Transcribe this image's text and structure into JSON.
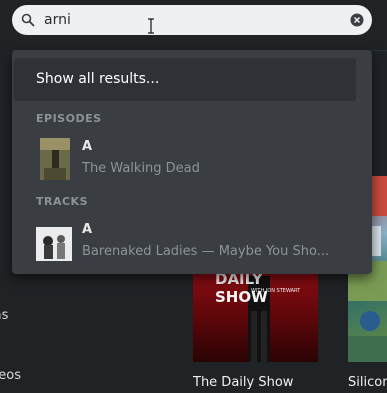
{
  "search": {
    "value": "arni",
    "placeholder": ""
  },
  "dropdown": {
    "show_all_label": "Show all results...",
    "sections": [
      {
        "header": "EPISODES",
        "items": [
          {
            "title": "A",
            "subtitle": "The Walking Dead"
          }
        ]
      },
      {
        "header": "TRACKS",
        "items": [
          {
            "title": "A",
            "subtitle": "Barenaked Ladies — Maybe You Sho..."
          }
        ]
      }
    ]
  },
  "sidebar": {
    "items": [
      "ias",
      "e",
      "deos"
    ]
  },
  "posters": [
    {
      "title": "The Daily Show",
      "poster_text": "DAILY SHOW",
      "poster_subtext": "WITH JON STEWART"
    },
    {
      "title": "Silicon"
    }
  ],
  "colors": {
    "background": "#1f2326",
    "dropdown": "#3a3e42",
    "search_bar": "#eef0f2",
    "accent_red": "#9a0f16"
  }
}
